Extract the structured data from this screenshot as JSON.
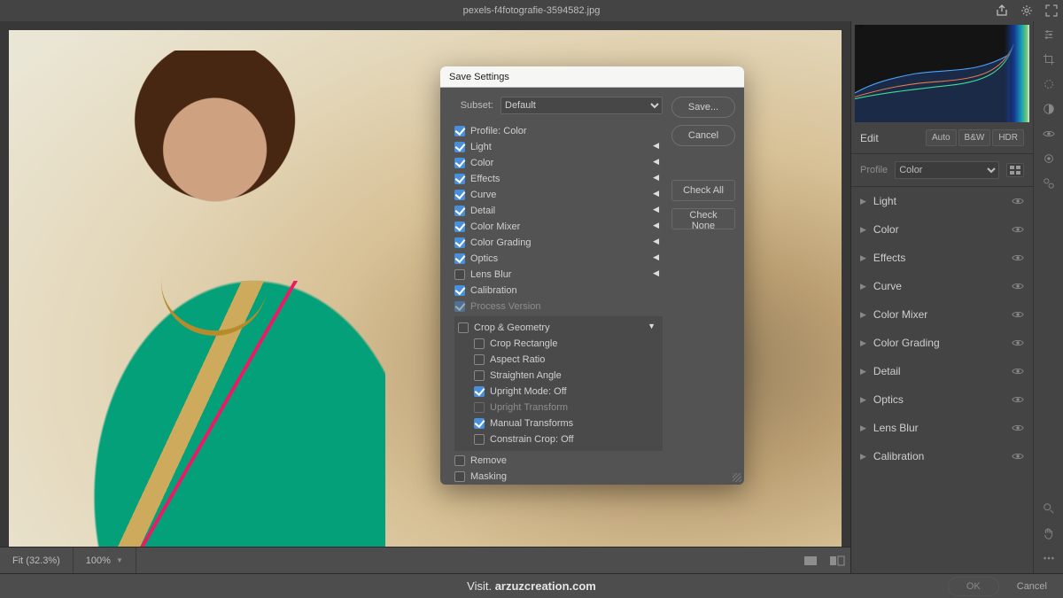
{
  "top": {
    "filename": "pexels-f4fotografie-3594582.jpg"
  },
  "status": {
    "fit": "Fit (32.3%)",
    "zoom": "100%"
  },
  "footer": {
    "visit_prefix": "Visit. ",
    "visit_bold": "arzuzcreation.com",
    "ok": "OK",
    "cancel": "Cancel"
  },
  "edit_panel": {
    "title": "Edit",
    "auto": "Auto",
    "bw": "B&W",
    "hdr": "HDR",
    "profile_label": "Profile",
    "profile_value": "Color",
    "sections": [
      "Light",
      "Color",
      "Effects",
      "Curve",
      "Color Mixer",
      "Color Grading",
      "Detail",
      "Optics",
      "Lens Blur",
      "Calibration"
    ]
  },
  "dialog": {
    "title": "Save Settings",
    "subset_label": "Subset:",
    "subset_value": "Default",
    "save": "Save...",
    "cancel": "Cancel",
    "check_all": "Check All",
    "check_none": "Check None",
    "items": [
      {
        "label": "Profile: Color",
        "chk": true
      },
      {
        "label": "Light",
        "chk": true,
        "dis": "left"
      },
      {
        "label": "Color",
        "chk": true,
        "dis": "left"
      },
      {
        "label": "Effects",
        "chk": true,
        "dis": "left"
      },
      {
        "label": "Curve",
        "chk": true,
        "dis": "left"
      },
      {
        "label": "Detail",
        "chk": true,
        "dis": "left"
      },
      {
        "label": "Color Mixer",
        "chk": true,
        "dis": "left"
      },
      {
        "label": "Color Grading",
        "chk": true,
        "dis": "left"
      },
      {
        "label": "Optics",
        "chk": true,
        "dis": "left"
      },
      {
        "label": "Lens Blur",
        "chk": false,
        "dis": "left"
      },
      {
        "label": "Calibration",
        "chk": true
      },
      {
        "label": "Process Version",
        "chk": true,
        "dim": true,
        "disabled": true
      }
    ],
    "crop_group": {
      "label": "Crop & Geometry",
      "chk": false,
      "dis": "down",
      "children": [
        {
          "label": "Crop Rectangle",
          "chk": false
        },
        {
          "label": "Aspect Ratio",
          "chk": false
        },
        {
          "label": "Straighten Angle",
          "chk": false
        },
        {
          "label": "Upright Mode: Off",
          "chk": true
        },
        {
          "label": "Upright Transform",
          "chk": false,
          "dim": true,
          "disabled": true
        },
        {
          "label": "Manual Transforms",
          "chk": true
        },
        {
          "label": "Constrain Crop: Off",
          "chk": false
        }
      ]
    },
    "tail": [
      {
        "label": "Remove",
        "chk": false
      },
      {
        "label": "Masking",
        "chk": false
      }
    ]
  }
}
